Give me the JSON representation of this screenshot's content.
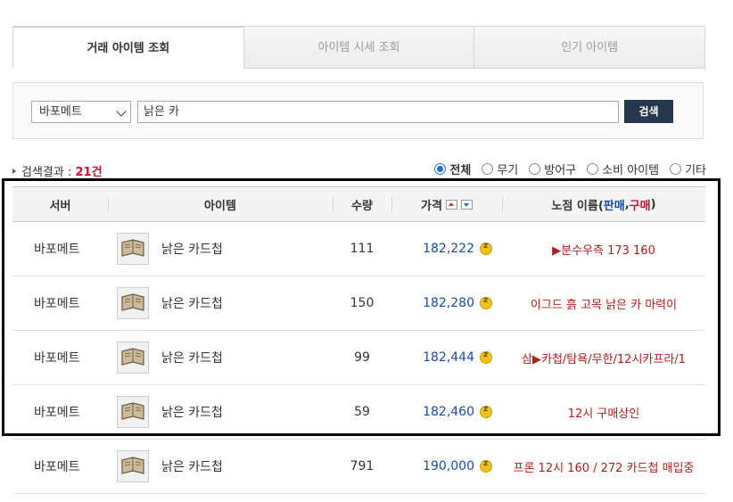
{
  "tabs": [
    {
      "label": "거래 아이템 조회",
      "active": true
    },
    {
      "label": "아이템 시세 조회",
      "active": false
    },
    {
      "label": "인기 아이템",
      "active": false
    }
  ],
  "search": {
    "server": "바포메트",
    "query": "낡은 카",
    "button_label": "검색"
  },
  "results": {
    "label": "검색결과 : ",
    "count": "21건"
  },
  "filters": [
    {
      "label": "전체",
      "checked": true
    },
    {
      "label": "무기",
      "checked": false
    },
    {
      "label": "방어구",
      "checked": false
    },
    {
      "label": "소비 아이템",
      "checked": false
    },
    {
      "label": "기타",
      "checked": false
    }
  ],
  "table": {
    "headers": {
      "server": "서버",
      "item": "아이템",
      "quantity": "수량",
      "price": "가격",
      "shop_prefix": "노점 이름(",
      "shop_sell": "판매",
      "shop_sep": ", ",
      "shop_buy": "구매",
      "shop_suffix": ")"
    },
    "rows": [
      {
        "server": "바포메트",
        "item": "낡은 카드첩",
        "quantity": "111",
        "price": "182,222",
        "shop": "▶분수우측 173 160"
      },
      {
        "server": "바포메트",
        "item": "낡은 카드첩",
        "quantity": "150",
        "price": "182,280",
        "shop": "이그드 흙 고목 낡은 카 마력이"
      },
      {
        "server": "바포메트",
        "item": "낡은 카드첩",
        "quantity": "99",
        "price": "182,444",
        "shop": "삼▶카첩/탐욕/무한/12시카프라/1"
      },
      {
        "server": "바포메트",
        "item": "낡은 카드첩",
        "quantity": "59",
        "price": "182,460",
        "shop": "12시 구매상인"
      },
      {
        "server": "바포메트",
        "item": "낡은 카드첩",
        "quantity": "791",
        "price": "190,000",
        "shop": "프론 12시 160 / 272 카드첩 매입중"
      }
    ]
  },
  "colors": {
    "accent_red": "#c8102e",
    "price_blue": "#1a4ba8",
    "button_navy": "#25384f"
  }
}
